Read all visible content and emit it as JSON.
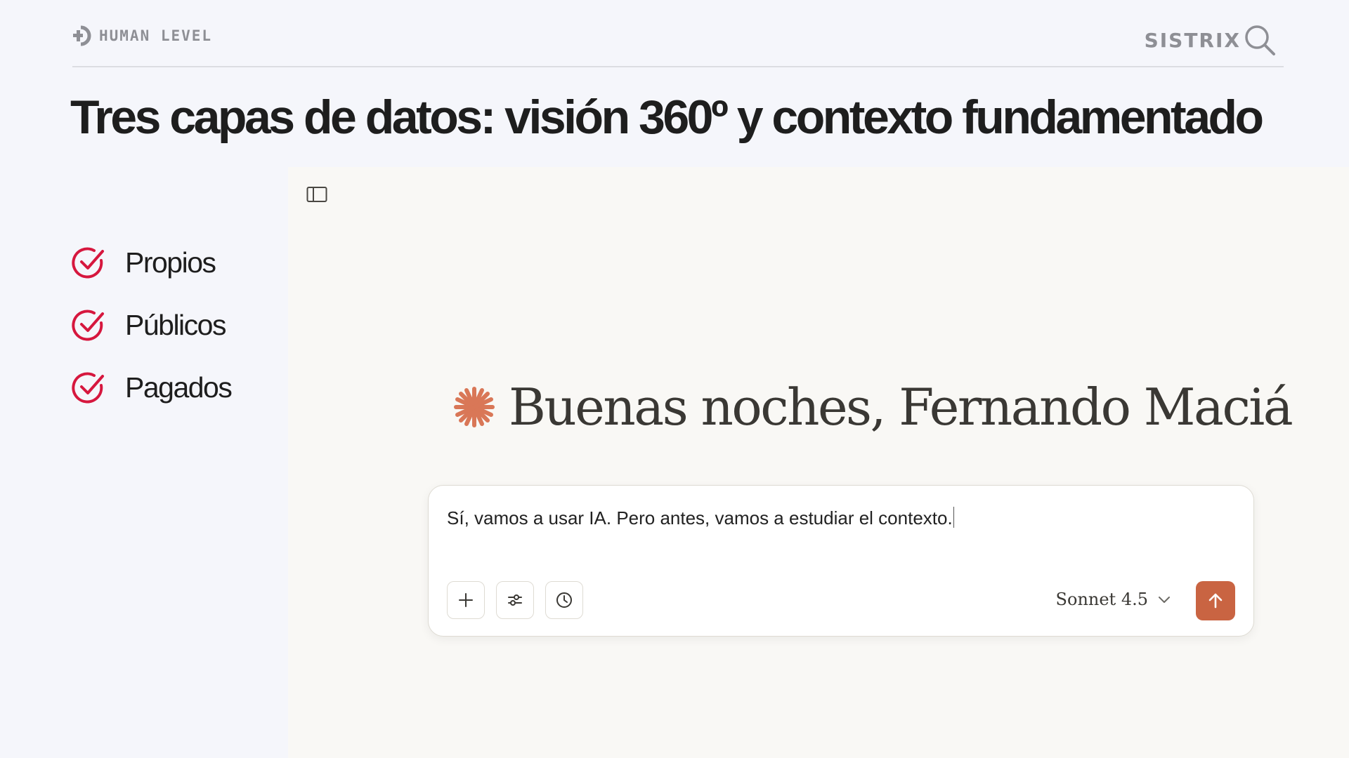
{
  "header": {
    "left_brand": "HUMAN LEVEL",
    "left_brand_icon": "human-level-logo",
    "right_brand": "SISTRIX",
    "right_brand_icon": "magnifier-icon"
  },
  "slide": {
    "title": "Tres capas de datos: visión 360º y contexto fundamentado"
  },
  "checklist": {
    "icon": "check-circle-icon",
    "color": "#d6173e",
    "items": [
      {
        "label": "Propios"
      },
      {
        "label": "Públicos"
      },
      {
        "label": "Pagados"
      }
    ]
  },
  "app": {
    "sidebar_toggle_icon": "sidebar-toggle-icon",
    "greeting": "Buenas noches, Fernando Maciá",
    "greeting_icon": "spark-icon",
    "accent_color": "#c96442",
    "composer": {
      "input_value": "Sí, vamos a usar IA. Pero antes, vamos a estudiar el contexto.",
      "tools": [
        {
          "icon": "plus-icon"
        },
        {
          "icon": "sliders-icon"
        },
        {
          "icon": "clock-icon"
        }
      ],
      "model": "Sonnet 4.5",
      "model_dropdown_icon": "chevron-down-icon",
      "send_icon": "arrow-up-icon"
    }
  }
}
